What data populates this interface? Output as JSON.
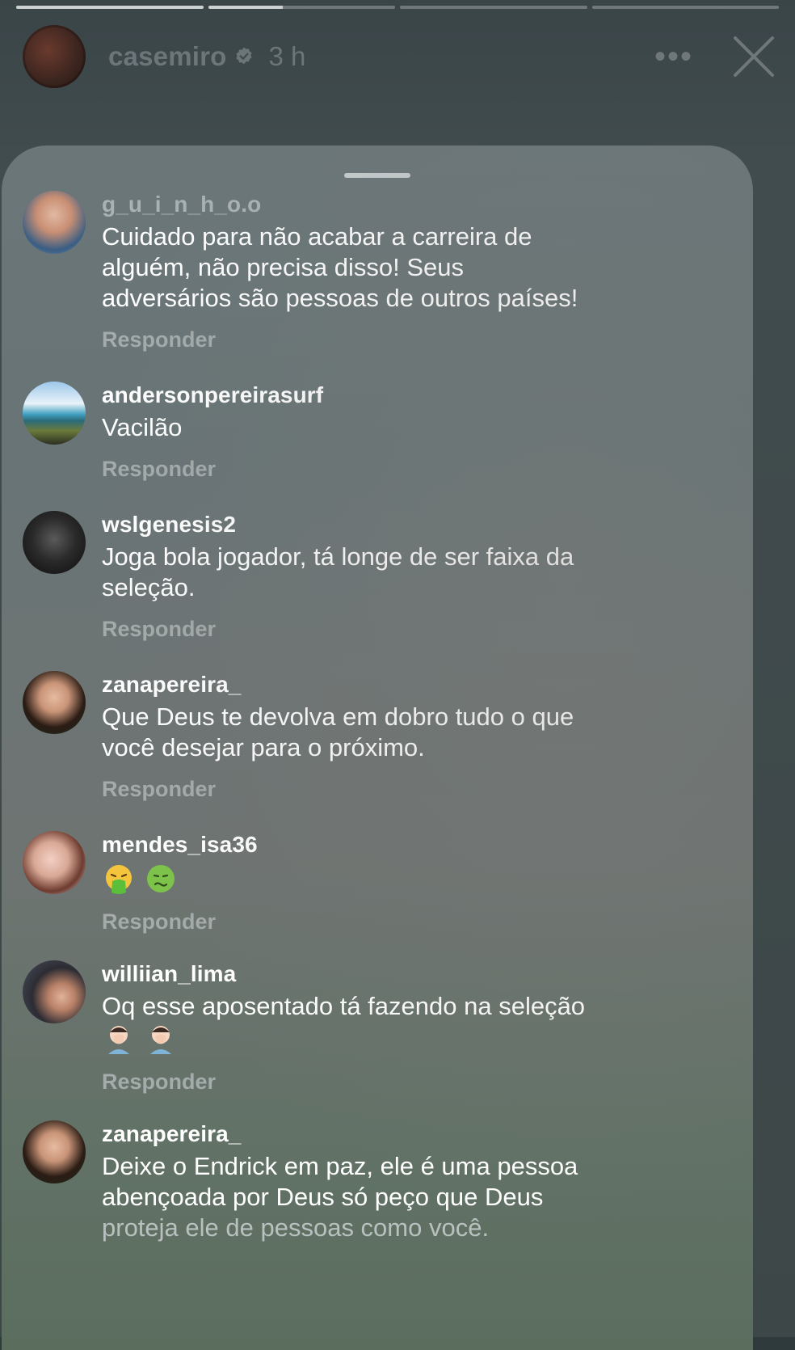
{
  "story": {
    "progress": [
      1.0,
      0.4,
      0.0,
      0.0
    ],
    "username": "casemiro",
    "time": "3 h",
    "more_icon": "•••"
  },
  "comments": [
    {
      "user": "g_u_i_n_h_o.o",
      "text": "Cuidado para não acabar a carreira de\nalguém, não precisa disso! Seus\nadversários são pessoas de outros países!",
      "reply": "Responder"
    },
    {
      "user": "andersonpereirasurf",
      "text": "Vacilão",
      "reply": "Responder"
    },
    {
      "user": "wslgenesis2",
      "text": "Joga bola jogador, tá longe de ser faixa da\nseleção.",
      "reply": "Responder"
    },
    {
      "user": "zanapereira_",
      "text": "Que Deus te devolva em dobro tudo o que\nvocê desejar para o próximo.",
      "reply": "Responder"
    },
    {
      "user": "mendes_isa36",
      "emojis": [
        "vomiting-face",
        "nauseated-face"
      ],
      "reply": "Responder"
    },
    {
      "user": "williian_lima",
      "text": "Oq esse aposentado tá fazendo na seleção",
      "emojis": [
        "man-facepalming",
        "man-facepalming"
      ],
      "reply": "Responder"
    },
    {
      "user": "zanapereira_",
      "text_main": "Deixe o Endrick em paz, ele é uma pessoa\nabençoada por Deus só peço que Deus",
      "text_faded": "proteja ele de pessoas como você."
    }
  ]
}
